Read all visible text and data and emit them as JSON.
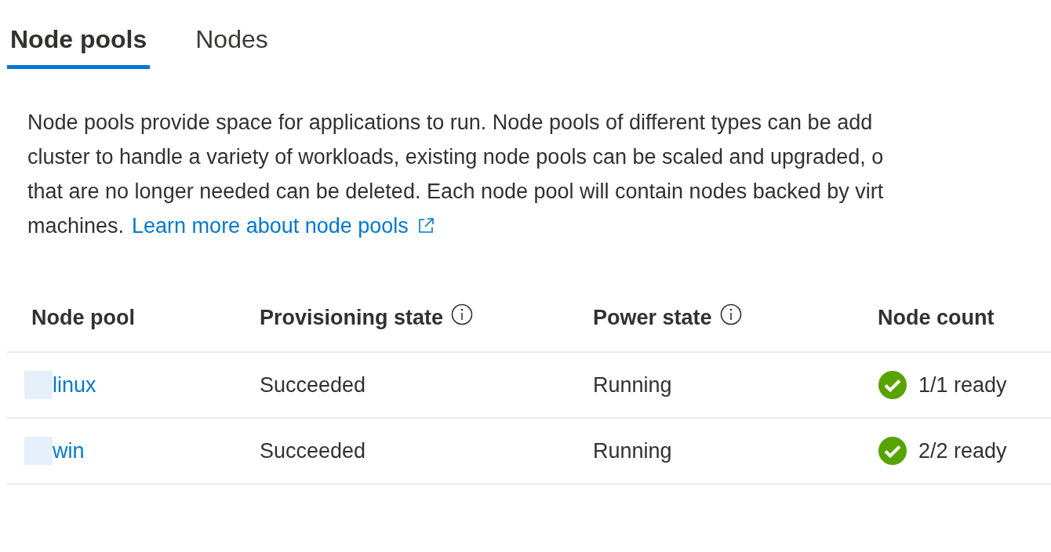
{
  "tabs": [
    {
      "label": "Node pools",
      "selected": true
    },
    {
      "label": "Nodes",
      "selected": false
    }
  ],
  "description": {
    "lines": [
      "Node pools provide space for applications to run. Node pools of different types can be add",
      "cluster to handle a variety of workloads, existing node pools can be scaled and upgraded, o",
      "that are no longer needed can be deleted. Each node pool will contain nodes backed by virt",
      "machines."
    ],
    "link": "Learn more about node pools"
  },
  "table": {
    "columns": [
      {
        "label": "Node pool",
        "info": false
      },
      {
        "label": "Provisioning state",
        "info": true
      },
      {
        "label": "Power state",
        "info": true
      },
      {
        "label": "Node count",
        "info": false
      }
    ],
    "rows": [
      {
        "name": "linux",
        "provisioning": "Succeeded",
        "power": "Running",
        "count": "1/1 ready",
        "ready": true
      },
      {
        "name": "win",
        "provisioning": "Succeeded",
        "power": "Running",
        "count": "2/2 ready",
        "ready": true
      }
    ]
  }
}
